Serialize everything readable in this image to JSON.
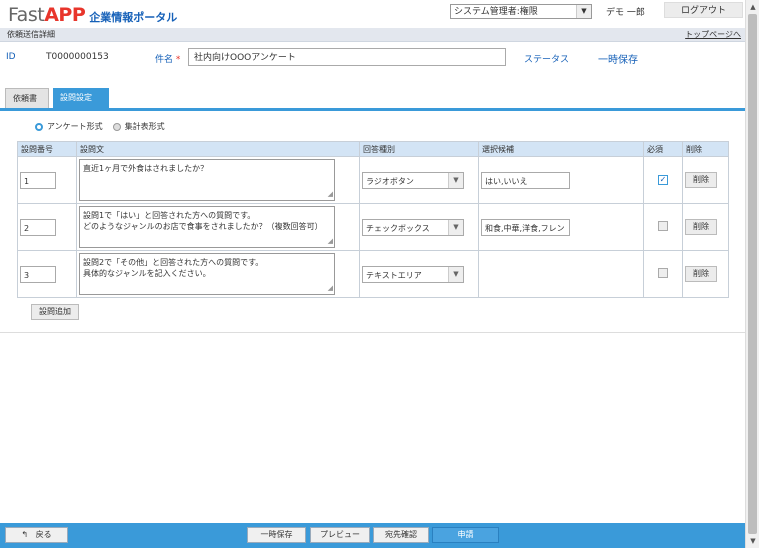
{
  "header": {
    "logo_fast": "Fast",
    "logo_app": "APP",
    "portal_title": "企業情報ポータル",
    "role_select_value": "システム管理者:権限",
    "user_name": "デモ 一郎",
    "logout_label": "ログアウト"
  },
  "titlebar": {
    "title": "依頼送信詳細",
    "top_link": "トップページへ"
  },
  "info": {
    "id_label": "ID",
    "id_value": "T0000000153",
    "subject_label": "件名",
    "subject_required_mark": "*",
    "subject_value": "社内向けOOOアンケート",
    "status_label": "ステータス",
    "status_value": "一時保存"
  },
  "tabs": [
    {
      "label": "依頼書"
    },
    {
      "label": "設問設定"
    }
  ],
  "form_type": {
    "options": [
      "アンケート形式",
      "集計表形式"
    ],
    "selected": "アンケート形式"
  },
  "table": {
    "headers": [
      "設問番号",
      "設問文",
      "回答種別",
      "選択候補",
      "必須",
      "削除"
    ],
    "rows": [
      {
        "number": "1",
        "text": "直近1ヶ月で外食はされましたか？",
        "type": "ラジオボタン",
        "choices": "はい,いいえ",
        "required": true,
        "delete_label": "削除"
      },
      {
        "number": "2",
        "text": "設問1で「はい」と回答された方への質問です。\nどのようなジャンルのお店で食事をされましたか？（複数回答可）",
        "type": "チェックボックス",
        "choices": "和食,中華,洋食,フレン",
        "required": false,
        "delete_label": "削除"
      },
      {
        "number": "3",
        "text": "設問2で「その他」と回答された方への質問です。\n具体的なジャンルを記入ください。",
        "type": "テキストエリア",
        "choices": "",
        "required": false,
        "delete_label": "削除"
      }
    ]
  },
  "add_question_label": "設問追加",
  "footer": {
    "back_label": "戻る",
    "buttons": [
      "一時保存",
      "プレビュー",
      "宛先確認"
    ],
    "submit_label": "申請"
  },
  "colors": {
    "brand_red": "#e8352b",
    "brand_blue": "#1560b8",
    "accent_blue": "#3a9ad9"
  }
}
